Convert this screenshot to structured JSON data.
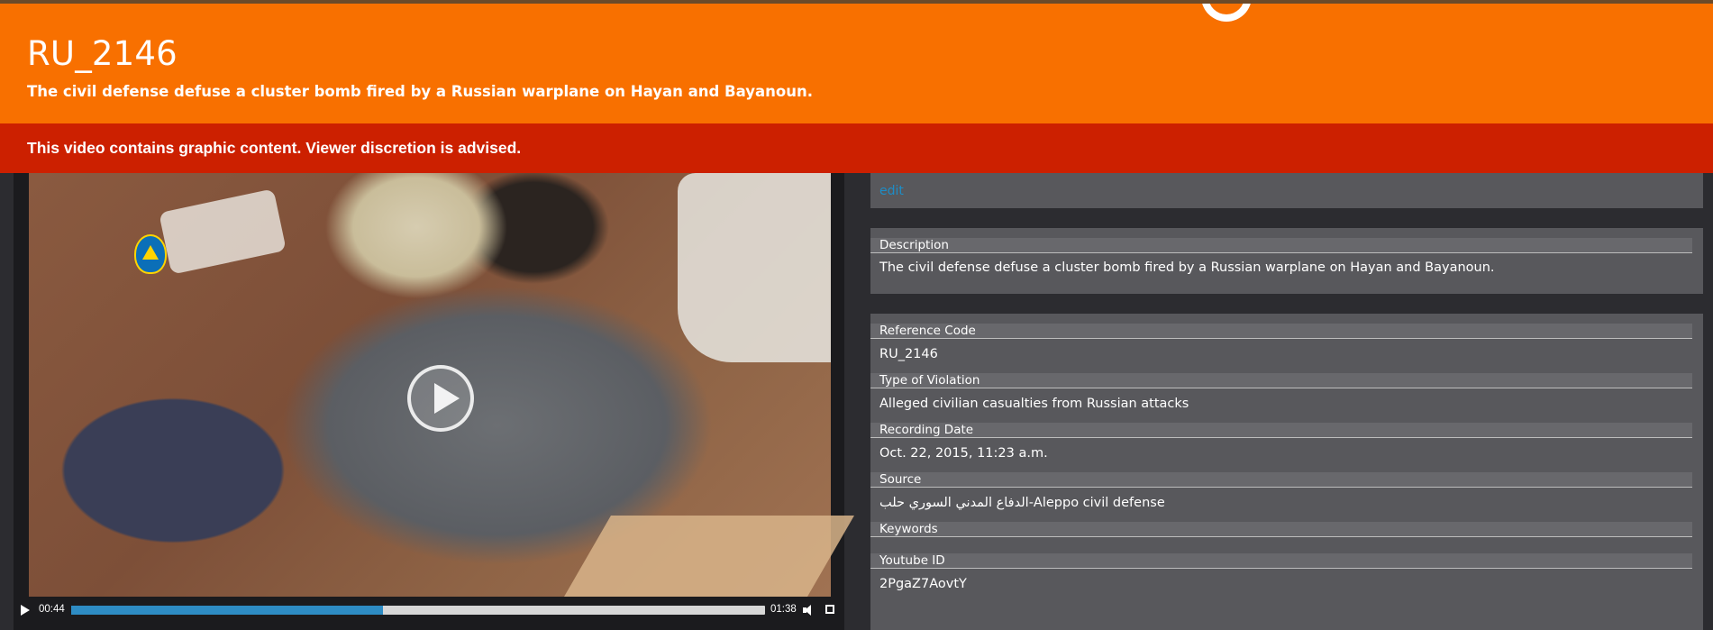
{
  "header": {
    "title": "RU_2146",
    "subtitle": "The civil defense defuse a cluster bomb fired by a Russian warplane on Hayan and Bayanoun."
  },
  "warning": {
    "text": "This video contains graphic content. Viewer discretion is advised."
  },
  "video": {
    "current_time": "00:44",
    "total_time": "01:38",
    "progress_fraction": 0.449,
    "icons": [
      "play-icon",
      "volume-icon",
      "fullscreen-icon",
      "play-overlay-icon"
    ],
    "progress_color": "#2e8cc4"
  },
  "details": {
    "edit_label": "edit",
    "description": {
      "label": "Description",
      "value": "The civil defense defuse a cluster bomb fired by a Russian warplane on Hayan and Bayanoun."
    },
    "fields": [
      {
        "label": "Reference Code",
        "value": "RU_2146"
      },
      {
        "label": "Type of Violation",
        "value": "Alleged civilian casualties from Russian attacks"
      },
      {
        "label": "Recording Date",
        "value": "Oct. 22, 2015, 11:23 a.m."
      },
      {
        "label": "Source",
        "value": "الدفاع المدني السوري حلب-Aleppo civil defense"
      },
      {
        "label": "Keywords",
        "value": ""
      },
      {
        "label": "Youtube ID",
        "value": "2PgaZ7AovtY"
      }
    ]
  },
  "colors": {
    "banner": "#f87000",
    "warning": "#cc2000",
    "link": "#1d8dc7"
  }
}
